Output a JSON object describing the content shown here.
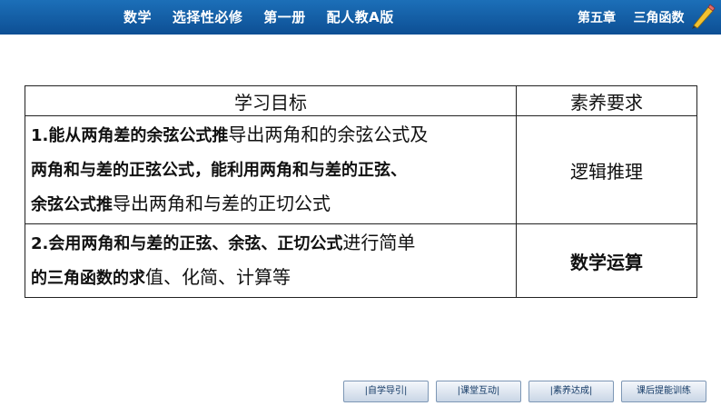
{
  "header": {
    "course": "数学    选择性必修    第一册    配人教A版",
    "chapter": "第五章    三角函数"
  },
  "table": {
    "headers": [
      "学习目标",
      "素养要求"
    ],
    "rows": [
      {
        "goal_bold_1": "1.能从两角差的余弦公式推",
        "goal_normal_1": "导出两角和的余弦公式及",
        "goal_bold_2": "两角和与差的正弦公式，能利用两角和与差的正弦、",
        "goal_bold_3": "余弦公式推",
        "goal_normal_3": "导出两角和与差的正切公式",
        "requirement": "逻辑推理"
      },
      {
        "goal_bold_1": "2.会用两角和与差的正弦、余弦、正切公式",
        "goal_normal_1": "进行简单",
        "goal_bold_2": "的三角函数的求",
        "goal_normal_2": "值、化简、计算等",
        "requirement": "数学运算"
      }
    ]
  },
  "nav": {
    "buttons": [
      "|自学导引|",
      "|课堂互动|",
      "|素养达成|",
      "课后提能训练"
    ]
  },
  "colors": {
    "header_bg": "#1565b0",
    "nav_text": "#143a66"
  }
}
